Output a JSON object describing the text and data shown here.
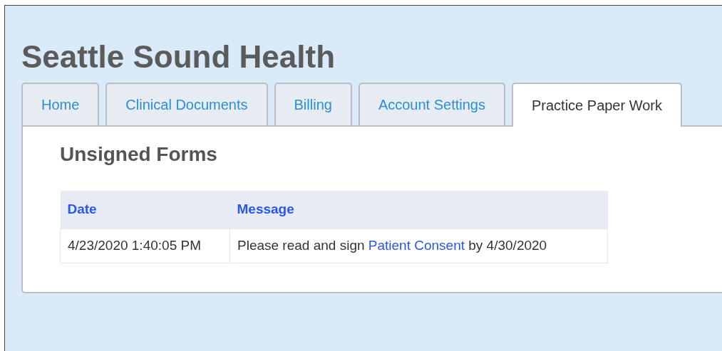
{
  "site_title": "Seattle Sound Health",
  "tabs": [
    {
      "label": "Home",
      "selected": false
    },
    {
      "label": "Clinical Documents",
      "selected": false
    },
    {
      "label": "Billing",
      "selected": false
    },
    {
      "label": "Account Settings",
      "selected": false
    },
    {
      "label": "Practice Paper Work",
      "selected": true
    }
  ],
  "section_title": "Unsigned Forms",
  "table": {
    "columns": [
      "Date",
      "Message"
    ],
    "rows": [
      {
        "date": "4/23/2020 1:40:05 PM",
        "message": {
          "before": "Please read and sign",
          "link": "Patient Consent",
          "after": "by 4/30/2020"
        }
      }
    ]
  }
}
